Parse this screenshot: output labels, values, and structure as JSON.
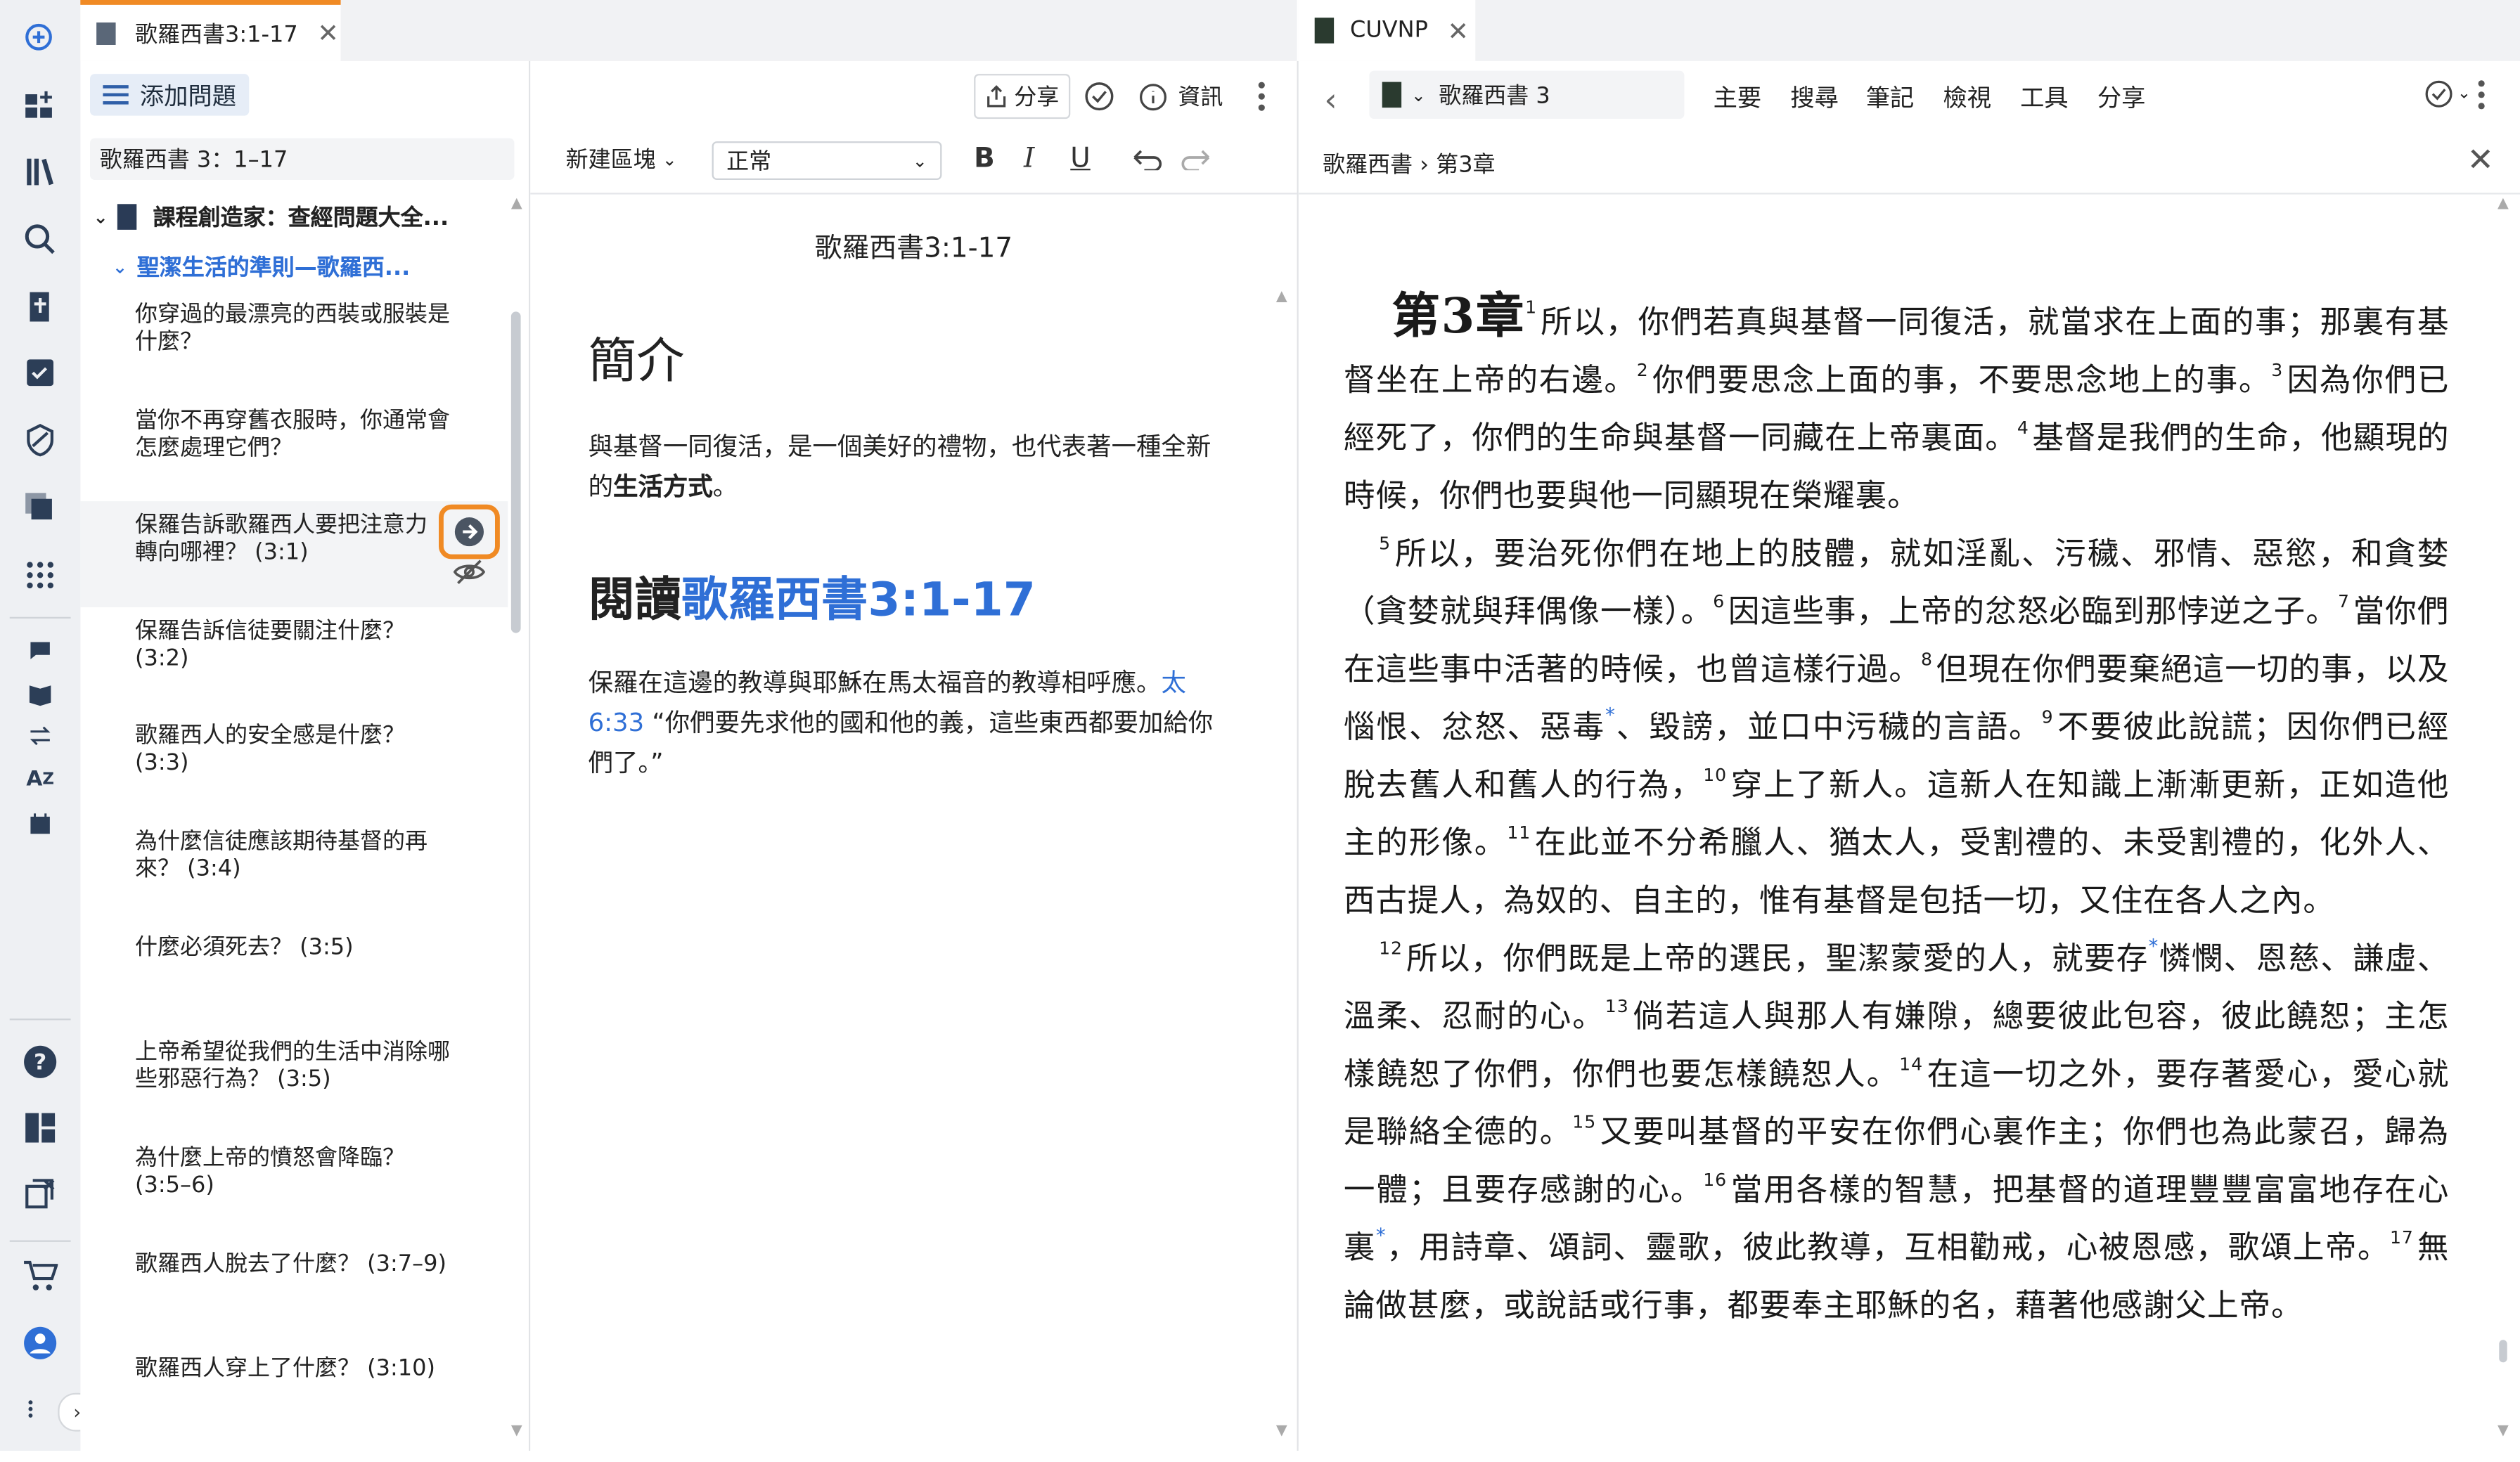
{
  "tabs": {
    "left": {
      "title": "歌羅西書3:1-17",
      "close": "✕"
    },
    "right": {
      "title": "CUVNP",
      "close": "✕"
    }
  },
  "question_pane": {
    "add_question": "添加問題",
    "share": "分享",
    "info": "資訊",
    "reference": "歌羅西書 3：1–17",
    "tree": {
      "root": "課程創造家：查經問題大全...",
      "section": "聖潔生活的準則—歌羅西..."
    },
    "questions": [
      "你穿過的最漂亮的西裝或服裝是什麼？",
      "當你不再穿舊衣服時，你通常會怎麼處理它們？",
      "保羅告訴歌羅西人要把注意力轉向哪裡？ (3:1)",
      "保羅告訴信徒要關注什麼？ (3:2)",
      "歌羅西人的安全感是什麼？ (3:3)",
      "為什麼信徒應該期待基督的再來？ (3:4)",
      "什麼必須死去？ (3:5)",
      "上帝希望從我們的生活中消除哪些邪惡行為？ (3:5)",
      "為什麼上帝的憤怒會降臨？ (3:5–6)",
      "歌羅西人脫去了什麼？ (3:7–9)",
      "歌羅西人穿上了什麼？ (3:10)"
    ]
  },
  "editor": {
    "new_block": "新建區塊",
    "style": "正常",
    "doc_title": "歌羅西書3:1-17",
    "h1": "簡介",
    "intro_pre": "與基督一同復活，是一個美好的禮物，也代表著一種全新的",
    "intro_bold": "生活方式",
    "intro_post": "。",
    "h2_pre": "閱讀",
    "h2_link": "歌羅西書3:1-17",
    "para_pre": "保羅在這邊的教導與耶穌在馬太福音的教導相呼應。",
    "para_link": "太6:33",
    "para_post": " “你們要先求他的國和他的義，這些東西都要加給你們了。”"
  },
  "bible": {
    "version_ref": "歌羅西書 3",
    "menu": [
      "主要",
      "搜尋",
      "筆記",
      "檢視",
      "工具",
      "分享"
    ],
    "breadcrumb": "歌羅西書 › 第3章",
    "chapter": "第3章",
    "verses": {
      "v1": "所以，你們若真與基督一同復活，就當求在上面的事；那裏有基督坐在上帝的右邊。",
      "v2": "你們要思念上面的事，不要思念地上的事。",
      "v3": "因為你們已經死了，你們的生命與基督一同藏在上帝裏面。",
      "v4": "基督是我們的生命，他顯現的時候，你們也要與他一同顯現在榮耀裏。",
      "v5": "所以，要治死你們在地上的肢體，就如淫亂、污穢、邪情、惡慾，和貪婪（貪婪就與拜偶像一樣）。",
      "v6": "因這些事，上帝的忿怒必臨到那悖逆之子。",
      "v7": "當你們在這些事中活著的時候，也曾這樣行過。",
      "v8a": "但現在你們要棄絕這一切的事，以及惱恨、忿怒、惡毒",
      "v8b": "、毀謗，並口中污穢的言語。",
      "v9": "不要彼此說謊；因你們已經脫去舊人和舊人的行為，",
      "v10": "穿上了新人。這新人在知識上漸漸更新，正如造他主的形像。",
      "v11": "在此並不分希臘人、猶太人，受割禮的、未受割禮的，化外人、西古提人，為奴的、自主的，惟有基督是包括一切，又住在各人之內。",
      "v12a": "所以，你們既是上帝的選民，聖潔蒙愛的人，就要存",
      "v12b": "憐憫、恩慈、謙虛、溫柔、忍耐的心。",
      "v13": "倘若這人與那人有嫌隙，總要彼此包容，彼此饒恕；主怎樣饒恕了你們，你們也要怎樣饒恕人。",
      "v14": "在這一切之外，要存著愛心，愛心就是聯絡全德的。",
      "v15": "又要叫基督的平安在你們心裏作主；你們也為此蒙召，歸為一體；且要存感謝的心。",
      "v16a": "當用各樣的智慧，把基督的道理豐豐富富地存在心裏",
      "v16b": "，用詩章、頌詞、靈歌，彼此教導，互相勸戒，心被恩感，歌頌上帝。",
      "v17": "無論做甚麼，或說話或行事，都要奉主耶穌的名，藉著他感謝父上帝。"
    },
    "footnote_mark": "*"
  },
  "colors": {
    "accent": "#2f6fd6",
    "highlight": "#f08a24"
  }
}
